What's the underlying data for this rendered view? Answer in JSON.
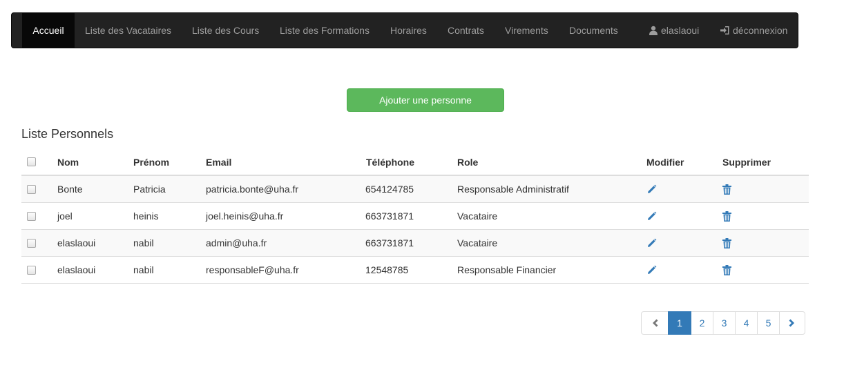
{
  "navbar": {
    "items": [
      {
        "label": "Accueil",
        "active": true
      },
      {
        "label": "Liste des Vacataires"
      },
      {
        "label": "Liste des Cours"
      },
      {
        "label": "Liste des Formations"
      },
      {
        "label": "Horaires"
      },
      {
        "label": "Contrats"
      },
      {
        "label": "Virements"
      },
      {
        "label": "Documents"
      }
    ],
    "user": {
      "label": "elaslaoui",
      "icon": "user-icon"
    },
    "logout": {
      "label": "déconnexion",
      "icon": "log-in-icon"
    }
  },
  "actions": {
    "add_label": "Ajouter une personne"
  },
  "list": {
    "title": "Liste Personnels",
    "columns": [
      "Nom",
      "Prénom",
      "Email",
      "Téléphone",
      "Role",
      "Modifier",
      "Supprimer"
    ],
    "rows": [
      {
        "nom": "Bonte",
        "prenom": "Patricia",
        "email": "patricia.bonte@uha.fr",
        "telephone": "654124785",
        "role": "Responsable Administratif"
      },
      {
        "nom": "joel",
        "prenom": "heinis",
        "email": "joel.heinis@uha.fr",
        "telephone": "663731871",
        "role": "Vacataire"
      },
      {
        "nom": "elaslaoui",
        "prenom": "nabil",
        "email": "admin@uha.fr",
        "telephone": "663731871",
        "role": "Vacataire"
      },
      {
        "nom": "elaslaoui",
        "prenom": "nabil",
        "email": "responsableF@uha.fr",
        "telephone": "12548785",
        "role": "Responsable Financier"
      }
    ],
    "row_icons": {
      "edit": "pencil-icon",
      "delete": "trash-icon"
    }
  },
  "pagination": {
    "pages": [
      "1",
      "2",
      "3",
      "4",
      "5"
    ],
    "current": "1",
    "prev_icon": "chevron-left-icon",
    "next_icon": "chevron-right-icon"
  },
  "colors": {
    "navbar_bg": "#222222",
    "navbar_active_bg": "#080808",
    "success": "#5cb85c",
    "primary": "#337ab7"
  }
}
